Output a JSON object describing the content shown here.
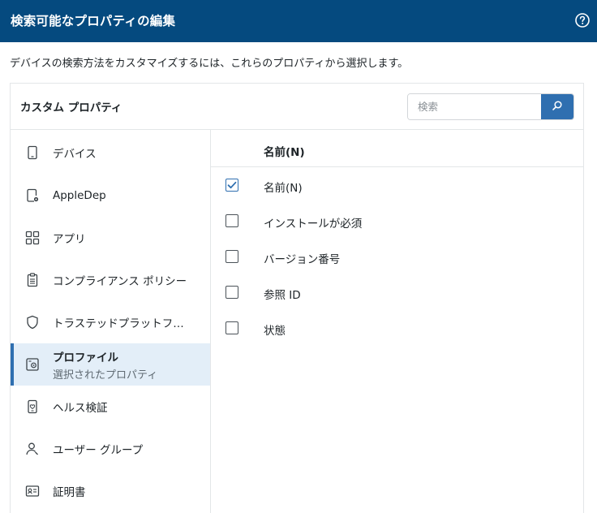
{
  "header": {
    "title": "検索可能なプロパティの編集",
    "help_icon": "help-circle-icon"
  },
  "description": "デバイスの検索方法をカスタマイズするには、これらのプロパティから選択します。",
  "panel": {
    "title": "カスタム プロパティ",
    "search": {
      "placeholder": "検索",
      "value": "",
      "button_icon": "search-icon"
    }
  },
  "sidebar": {
    "items": [
      {
        "label": "デバイス",
        "icon": "phone-icon"
      },
      {
        "label": "AppleDep",
        "icon": "device-gear-icon"
      },
      {
        "label": "アプリ",
        "icon": "apps-grid-icon"
      },
      {
        "label": "コンプライアンス ポリシー",
        "icon": "clipboard-icon"
      },
      {
        "label": "トラステッドプラットフ…",
        "icon": "shield-icon"
      },
      {
        "label": "プロファイル",
        "sublabel": "選択されたプロパティ",
        "icon": "profile-settings-icon",
        "selected": true
      },
      {
        "label": "ヘルス検証",
        "icon": "health-device-icon"
      },
      {
        "label": "ユーザー グループ",
        "icon": "user-icon"
      },
      {
        "label": "証明書",
        "icon": "certificate-icon"
      }
    ]
  },
  "content": {
    "column_header": "名前(N)",
    "rows": [
      {
        "label": "名前(N)",
        "checked": true
      },
      {
        "label": "インストールが必須",
        "checked": false
      },
      {
        "label": "バージョン番号",
        "checked": false
      },
      {
        "label": "参照 ID",
        "checked": false
      },
      {
        "label": "状態",
        "checked": false
      }
    ]
  },
  "colors": {
    "header_bg": "#054a7f",
    "accent": "#2f6fb0",
    "selected_bg": "#e3eef8"
  }
}
